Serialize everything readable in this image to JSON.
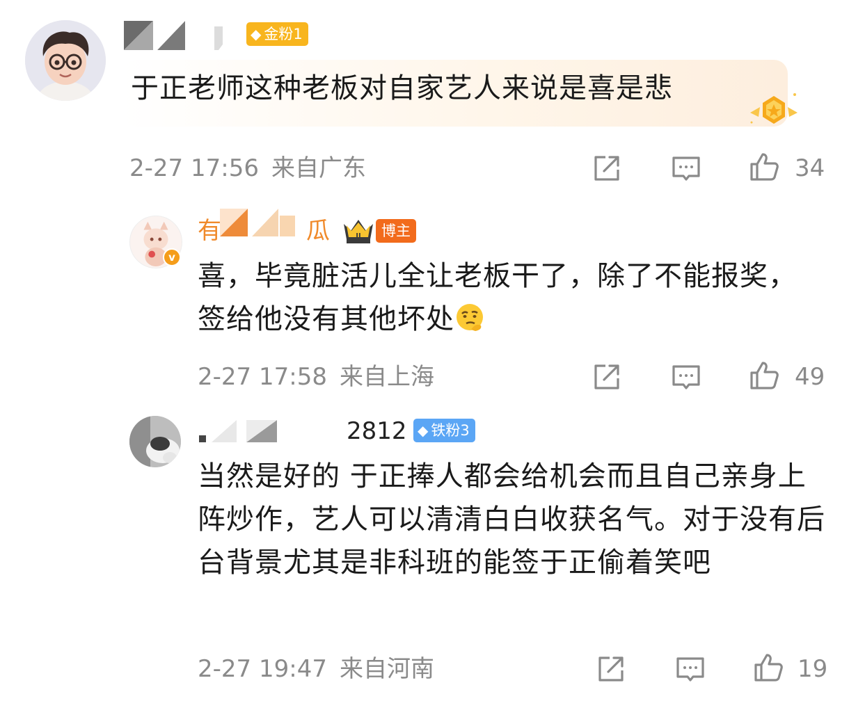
{
  "comments": {
    "main": {
      "badge": "金粉1",
      "text": "于正老师这种老板对自家艺人来说是喜是悲",
      "time": "2-27 17:56",
      "location": "来自广东",
      "likes": "34"
    },
    "reply1": {
      "name_start": "有",
      "name_end": "瓜",
      "crown_level": "II",
      "verified_mark": "v",
      "badge": "博主",
      "text": "喜，毕竟脏活儿全让老板干了，除了不能报奖，签给他没有其他坏处",
      "emoji": "thinking-emoji",
      "time": "2-27 17:58",
      "location": "来自上海",
      "likes": "49"
    },
    "reply2": {
      "name_tail": "2812",
      "badge": "铁粉3",
      "text": "当然是好的 于正捧人都会给机会而且自己亲身上阵炒作，艺人可以清清白白收获名气。对于没有后台背景尤其是非科班的能签于正偷着笑吧",
      "time": "2-27 19:47",
      "location": "来自河南",
      "likes": "19"
    }
  },
  "icons": {
    "share": "share-icon",
    "comment": "comment-icon",
    "like": "thumbs-up-icon",
    "fan_badge": "diamond-icon",
    "medal": "gold-medal-icon"
  },
  "colors": {
    "meta_gray": "#8a8a8a",
    "gold_badge": "#f8b51e",
    "blogger_badge": "#f26b1c",
    "iron_badge": "#5ba6f5",
    "username_orange": "#f08a2b"
  }
}
